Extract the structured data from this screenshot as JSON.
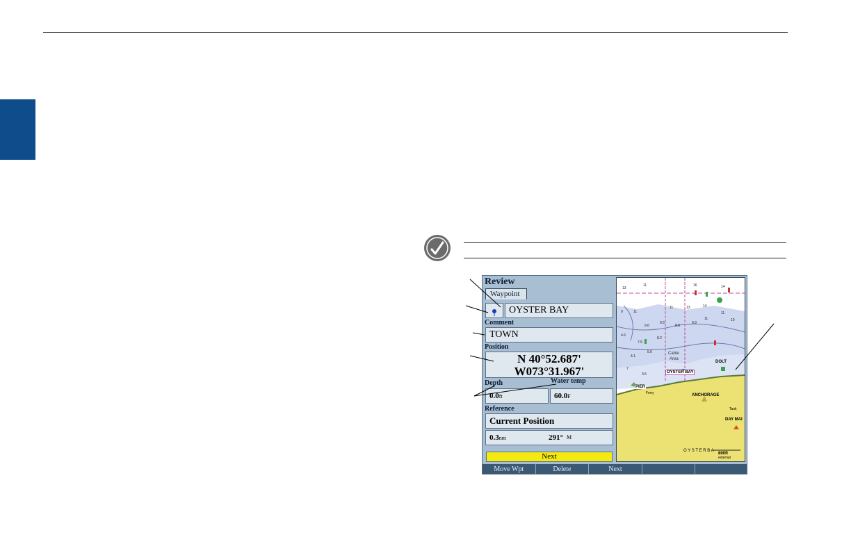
{
  "review": {
    "title": "Review",
    "tab_label": "Waypoint",
    "waypoint_name": "OYSTER BAY",
    "comment_label": "Comment",
    "comment_value": "TOWN",
    "position_label": "Position",
    "latitude": "N  40°52.687'",
    "longitude": "W073°31.967'",
    "depth_label": "Depth",
    "depth_value": "0.0",
    "depth_unit": "ft",
    "water_temp_label": "Water temp",
    "water_temp_value": "60.0",
    "water_temp_unit": "F",
    "reference_label": "Reference",
    "reference_value": "Current Position",
    "distance_value": "0.3",
    "distance_unit": "nm",
    "bearing_value": "291°",
    "bearing_unit": "M",
    "next_button": "Next"
  },
  "softkeys": [
    "Move Wpt",
    "Delete",
    "Next",
    "",
    ""
  ],
  "map": {
    "labels": {
      "oyster_bay": "OYSTER BAY",
      "anchorage": "ANCHORAGE",
      "pier": "PIER",
      "cable_area_1": "Cable",
      "cable_area_2": "Area",
      "dolt": "DOLT",
      "day_mark": "DAY MAI",
      "tank": "Tank",
      "ferry": "Ferry",
      "town": "O Y S T E R B A",
      "scale": "800ft",
      "overzoom": "external"
    },
    "depths": [
      "13",
      "11",
      "16",
      "14",
      "9",
      "11",
      "11",
      "13",
      "14",
      "11",
      "10",
      "9.6",
      "9.5",
      "8.8",
      "9.9",
      "11",
      "4.6",
      "7.5",
      "8.2",
      "4.1",
      "5.6",
      "7",
      "3.5"
    ]
  },
  "colors": {
    "side_tab": "#0e4c8c",
    "screen_bg": "#a8bfd3",
    "highlight": "#f4ea12",
    "softkey_bar": "#3b5874",
    "land": "#ece173",
    "shallow": "#cdd7f0"
  }
}
